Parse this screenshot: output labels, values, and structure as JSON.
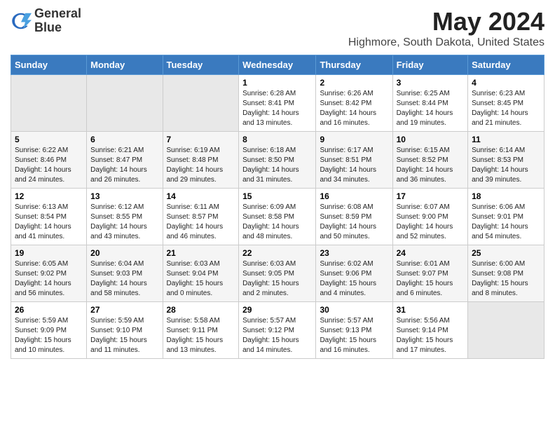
{
  "logo": {
    "line1": "General",
    "line2": "Blue"
  },
  "title": "May 2024",
  "subtitle": "Highmore, South Dakota, United States",
  "days_of_week": [
    "Sunday",
    "Monday",
    "Tuesday",
    "Wednesday",
    "Thursday",
    "Friday",
    "Saturday"
  ],
  "weeks": [
    [
      {
        "day": "",
        "info": ""
      },
      {
        "day": "",
        "info": ""
      },
      {
        "day": "",
        "info": ""
      },
      {
        "day": "1",
        "info": "Sunrise: 6:28 AM\nSunset: 8:41 PM\nDaylight: 14 hours\nand 13 minutes."
      },
      {
        "day": "2",
        "info": "Sunrise: 6:26 AM\nSunset: 8:42 PM\nDaylight: 14 hours\nand 16 minutes."
      },
      {
        "day": "3",
        "info": "Sunrise: 6:25 AM\nSunset: 8:44 PM\nDaylight: 14 hours\nand 19 minutes."
      },
      {
        "day": "4",
        "info": "Sunrise: 6:23 AM\nSunset: 8:45 PM\nDaylight: 14 hours\nand 21 minutes."
      }
    ],
    [
      {
        "day": "5",
        "info": "Sunrise: 6:22 AM\nSunset: 8:46 PM\nDaylight: 14 hours\nand 24 minutes."
      },
      {
        "day": "6",
        "info": "Sunrise: 6:21 AM\nSunset: 8:47 PM\nDaylight: 14 hours\nand 26 minutes."
      },
      {
        "day": "7",
        "info": "Sunrise: 6:19 AM\nSunset: 8:48 PM\nDaylight: 14 hours\nand 29 minutes."
      },
      {
        "day": "8",
        "info": "Sunrise: 6:18 AM\nSunset: 8:50 PM\nDaylight: 14 hours\nand 31 minutes."
      },
      {
        "day": "9",
        "info": "Sunrise: 6:17 AM\nSunset: 8:51 PM\nDaylight: 14 hours\nand 34 minutes."
      },
      {
        "day": "10",
        "info": "Sunrise: 6:15 AM\nSunset: 8:52 PM\nDaylight: 14 hours\nand 36 minutes."
      },
      {
        "day": "11",
        "info": "Sunrise: 6:14 AM\nSunset: 8:53 PM\nDaylight: 14 hours\nand 39 minutes."
      }
    ],
    [
      {
        "day": "12",
        "info": "Sunrise: 6:13 AM\nSunset: 8:54 PM\nDaylight: 14 hours\nand 41 minutes."
      },
      {
        "day": "13",
        "info": "Sunrise: 6:12 AM\nSunset: 8:55 PM\nDaylight: 14 hours\nand 43 minutes."
      },
      {
        "day": "14",
        "info": "Sunrise: 6:11 AM\nSunset: 8:57 PM\nDaylight: 14 hours\nand 46 minutes."
      },
      {
        "day": "15",
        "info": "Sunrise: 6:09 AM\nSunset: 8:58 PM\nDaylight: 14 hours\nand 48 minutes."
      },
      {
        "day": "16",
        "info": "Sunrise: 6:08 AM\nSunset: 8:59 PM\nDaylight: 14 hours\nand 50 minutes."
      },
      {
        "day": "17",
        "info": "Sunrise: 6:07 AM\nSunset: 9:00 PM\nDaylight: 14 hours\nand 52 minutes."
      },
      {
        "day": "18",
        "info": "Sunrise: 6:06 AM\nSunset: 9:01 PM\nDaylight: 14 hours\nand 54 minutes."
      }
    ],
    [
      {
        "day": "19",
        "info": "Sunrise: 6:05 AM\nSunset: 9:02 PM\nDaylight: 14 hours\nand 56 minutes."
      },
      {
        "day": "20",
        "info": "Sunrise: 6:04 AM\nSunset: 9:03 PM\nDaylight: 14 hours\nand 58 minutes."
      },
      {
        "day": "21",
        "info": "Sunrise: 6:03 AM\nSunset: 9:04 PM\nDaylight: 15 hours\nand 0 minutes."
      },
      {
        "day": "22",
        "info": "Sunrise: 6:03 AM\nSunset: 9:05 PM\nDaylight: 15 hours\nand 2 minutes."
      },
      {
        "day": "23",
        "info": "Sunrise: 6:02 AM\nSunset: 9:06 PM\nDaylight: 15 hours\nand 4 minutes."
      },
      {
        "day": "24",
        "info": "Sunrise: 6:01 AM\nSunset: 9:07 PM\nDaylight: 15 hours\nand 6 minutes."
      },
      {
        "day": "25",
        "info": "Sunrise: 6:00 AM\nSunset: 9:08 PM\nDaylight: 15 hours\nand 8 minutes."
      }
    ],
    [
      {
        "day": "26",
        "info": "Sunrise: 5:59 AM\nSunset: 9:09 PM\nDaylight: 15 hours\nand 10 minutes."
      },
      {
        "day": "27",
        "info": "Sunrise: 5:59 AM\nSunset: 9:10 PM\nDaylight: 15 hours\nand 11 minutes."
      },
      {
        "day": "28",
        "info": "Sunrise: 5:58 AM\nSunset: 9:11 PM\nDaylight: 15 hours\nand 13 minutes."
      },
      {
        "day": "29",
        "info": "Sunrise: 5:57 AM\nSunset: 9:12 PM\nDaylight: 15 hours\nand 14 minutes."
      },
      {
        "day": "30",
        "info": "Sunrise: 5:57 AM\nSunset: 9:13 PM\nDaylight: 15 hours\nand 16 minutes."
      },
      {
        "day": "31",
        "info": "Sunrise: 5:56 AM\nSunset: 9:14 PM\nDaylight: 15 hours\nand 17 minutes."
      },
      {
        "day": "",
        "info": ""
      }
    ]
  ],
  "colors": {
    "header_bg": "#3a7abf",
    "header_text": "#ffffff",
    "empty_cell_bg": "#e8e8e8",
    "odd_row_bg": "#ffffff",
    "even_row_bg": "#f5f5f5"
  }
}
